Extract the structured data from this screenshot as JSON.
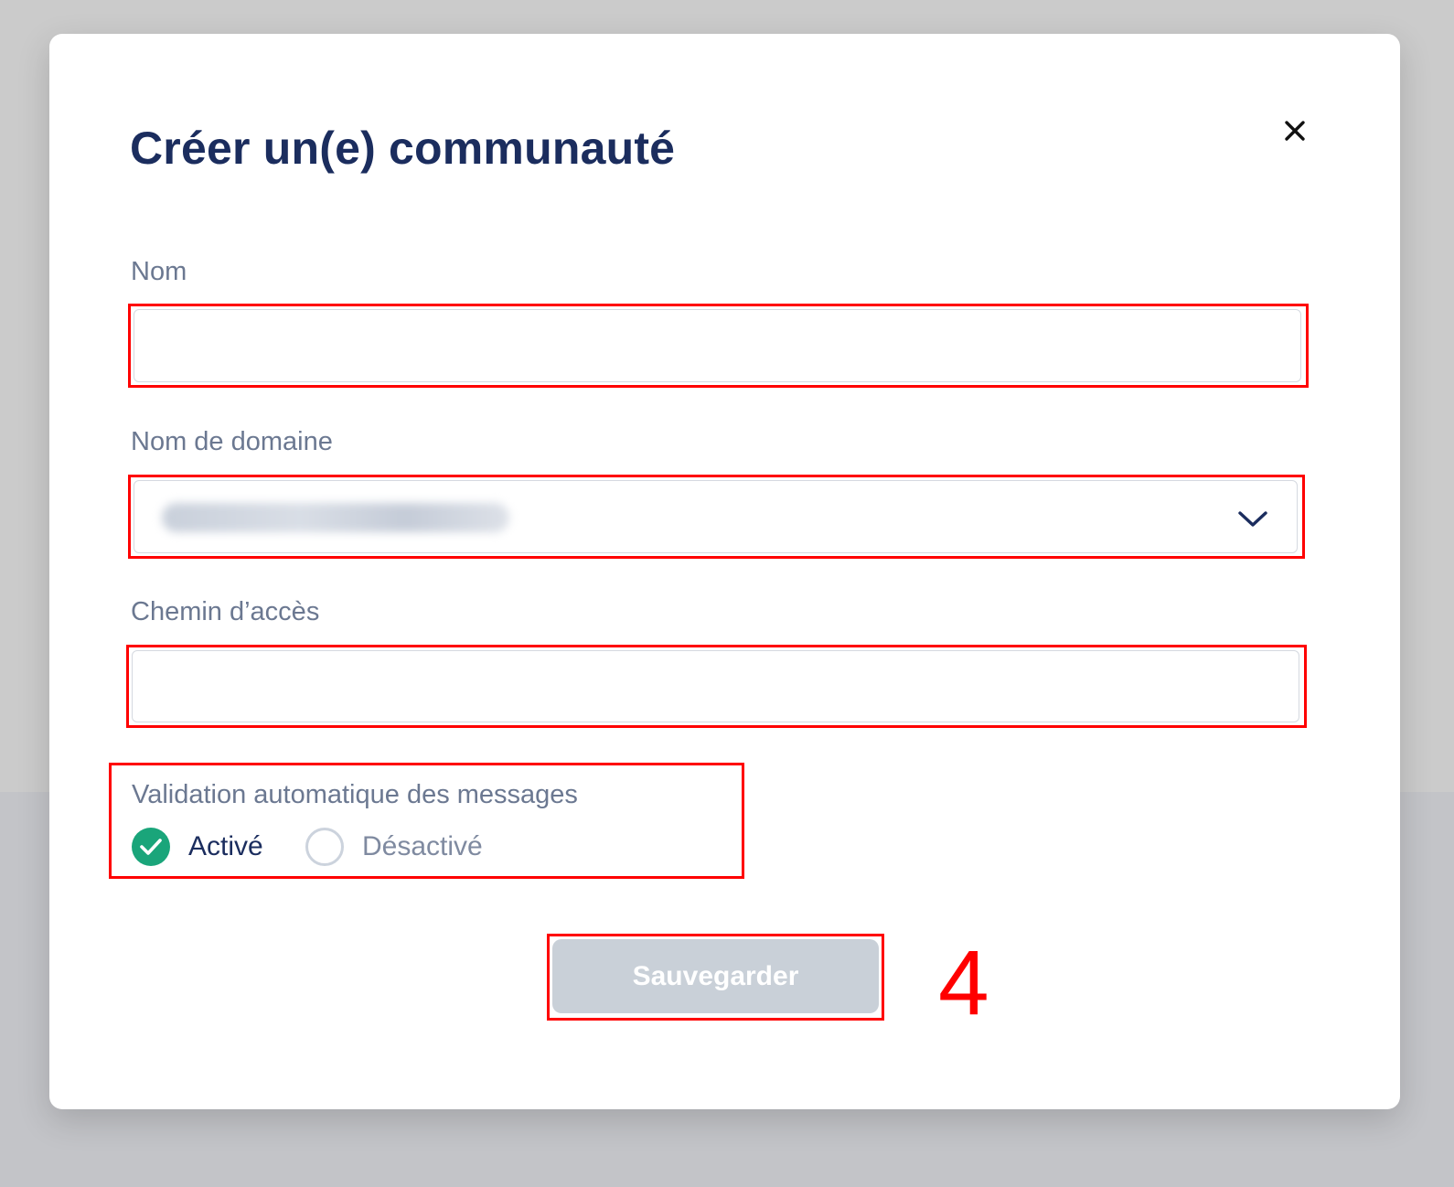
{
  "modal": {
    "title": "Créer un(e) communauté",
    "close_icon": "close-icon"
  },
  "form": {
    "name": {
      "label": "Nom",
      "value": ""
    },
    "domain": {
      "label": "Nom de domaine",
      "dropdown_icon": "chevron-down-icon"
    },
    "path": {
      "label": "Chemin d’accès",
      "value": ""
    },
    "auto_validation": {
      "label": "Validation automatique des messages",
      "options": [
        {
          "label": "Activé",
          "selected": true
        },
        {
          "label": "Désactivé",
          "selected": false
        }
      ]
    },
    "save_label": "Sauvegarder"
  },
  "annotation": {
    "step": "4"
  },
  "colors": {
    "title": "#1b2d5e",
    "label": "#6b7891",
    "accent_green": "#1aa57a",
    "highlight_red": "#ff0000",
    "disabled_button": "#c9d0d8"
  }
}
